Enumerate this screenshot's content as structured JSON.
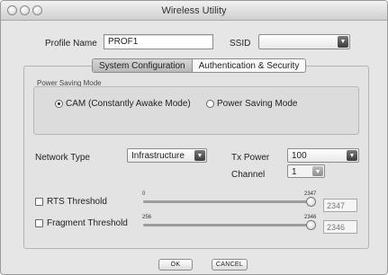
{
  "window": {
    "title": "Wireless Utility"
  },
  "profile": {
    "label": "Profile Name",
    "value": "PROF1"
  },
  "ssid": {
    "label": "SSID",
    "value": ""
  },
  "tabs": [
    {
      "label": "System Configuration",
      "active": true
    },
    {
      "label": "Authentication & Security",
      "active": false
    }
  ],
  "power_saving": {
    "title": "Power Saving Mode",
    "options": [
      {
        "label": "CAM (Constantly Awake Mode)",
        "selected": true
      },
      {
        "label": "Power Saving Mode",
        "selected": false
      }
    ]
  },
  "network_type": {
    "label": "Network Type",
    "value": "Infrastructure"
  },
  "tx_power": {
    "label": "Tx Power",
    "value": "100"
  },
  "channel": {
    "label": "Channel",
    "value": "1"
  },
  "rts": {
    "label": "RTS Threshold",
    "checked": false,
    "min": "0",
    "max": "2347",
    "value": "2347"
  },
  "fragment": {
    "label": "Fragment Threshold",
    "checked": false,
    "min": "256",
    "max": "2346",
    "value": "2346"
  },
  "buttons": {
    "ok": "OK",
    "cancel": "CANCEL"
  },
  "colors": {
    "window_bg": "#e6e6e6",
    "panel_bg": "#e3e3e3"
  }
}
